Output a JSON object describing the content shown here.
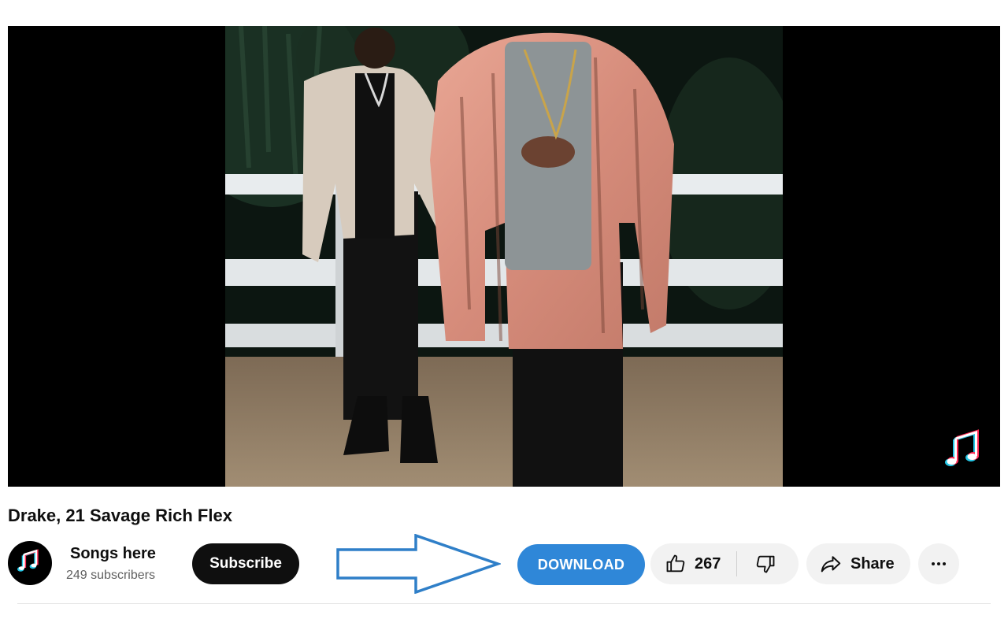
{
  "video": {
    "title": "Drake, 21 Savage Rich Flex"
  },
  "channel": {
    "name": "Songs here",
    "subscribers": "249 subscribers",
    "avatar_icon": "music-notes-icon"
  },
  "actions": {
    "subscribe_label": "Subscribe",
    "download_label": "DOWNLOAD",
    "like_count": "267",
    "share_label": "Share",
    "more_icon": "more-horiz-icon"
  },
  "colors": {
    "download": "#2f87d8",
    "subscribe": "#0f0f0f",
    "arrow_outline": "#2f7fc8",
    "pill_bg": "#f2f2f2"
  }
}
